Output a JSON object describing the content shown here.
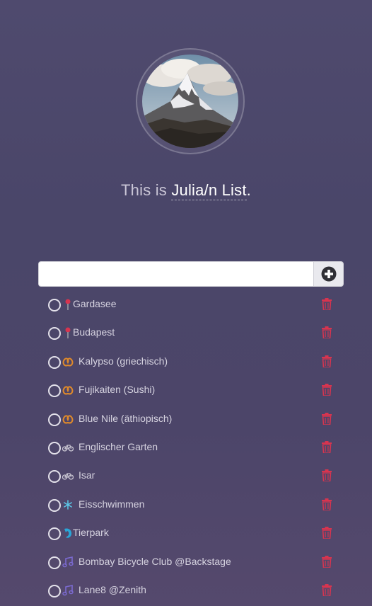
{
  "header": {
    "prefix": "This is ",
    "name": "Julia/n List",
    "suffix": "."
  },
  "input": {
    "value": "",
    "placeholder": ""
  },
  "colors": {
    "trash": "#d8344f",
    "pin": "#d8344f",
    "pretzel": "#e08a2a",
    "bike": "#c9c6d2",
    "snowflake": "#5cc8e8",
    "dolphin": "#2aa6d8",
    "music": "#7b6ad0"
  },
  "items": [
    {
      "label": "Gardasee",
      "icon": "pin-icon"
    },
    {
      "label": "Budapest",
      "icon": "pin-icon"
    },
    {
      "label": "Kalypso (griechisch)",
      "icon": "pretzel-icon"
    },
    {
      "label": "Fujikaiten (Sushi)",
      "icon": "pretzel-icon"
    },
    {
      "label": "Blue Nile (äthiopisch)",
      "icon": "pretzel-icon"
    },
    {
      "label": "Englischer Garten",
      "icon": "bicycle-icon"
    },
    {
      "label": "Isar",
      "icon": "bicycle-icon"
    },
    {
      "label": "Eisschwimmen",
      "icon": "snowflake-icon"
    },
    {
      "label": "Tierpark",
      "icon": "dolphin-icon"
    },
    {
      "label": "Bombay Bicycle Club @Backstage",
      "icon": "music-icon"
    },
    {
      "label": "Lane8 @Zenith",
      "icon": "music-icon"
    }
  ]
}
